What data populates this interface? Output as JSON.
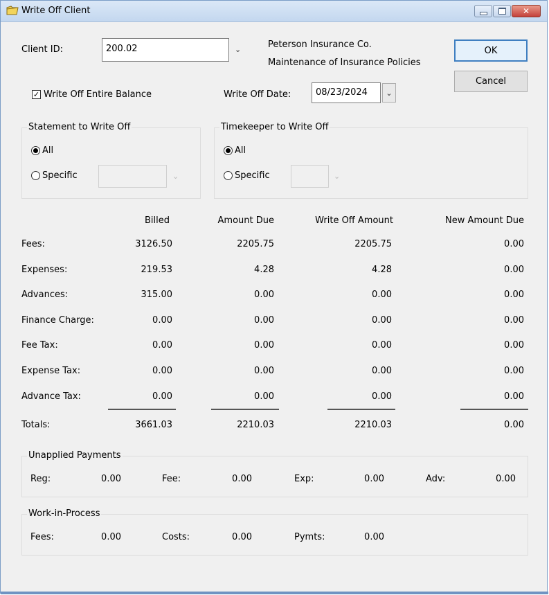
{
  "window": {
    "title": "Write Off Client",
    "icon": "folder-icon",
    "controls": [
      "minimize-icon",
      "maximize-icon",
      "close-icon"
    ]
  },
  "client": {
    "label": "Client ID:",
    "value": "200.02",
    "name": "Peterson Insurance Co.",
    "matter": "Maintenance of Insurance Policies"
  },
  "buttons": {
    "ok": "OK",
    "cancel": "Cancel"
  },
  "write_off_entire": {
    "label": "Write Off Entire Balance",
    "checked": true
  },
  "write_off_date": {
    "label": "Write Off Date:",
    "value": "08/23/2024"
  },
  "statement_group": {
    "title": "Statement to Write Off",
    "all_label": "All",
    "specific_label": "Specific",
    "selected": "All"
  },
  "timekeeper_group": {
    "title": "Timekeeper to Write Off",
    "all_label": "All",
    "specific_label": "Specific",
    "selected": "All"
  },
  "table": {
    "headers": [
      "Billed",
      "Amount Due",
      "Write Off Amount",
      "New Amount Due"
    ],
    "rows": [
      {
        "label": "Fees:",
        "billed": "3126.50",
        "due": "2205.75",
        "writeoff": "2205.75",
        "newdue": "0.00"
      },
      {
        "label": "Expenses:",
        "billed": "219.53",
        "due": "4.28",
        "writeoff": "4.28",
        "newdue": "0.00"
      },
      {
        "label": "Advances:",
        "billed": "315.00",
        "due": "0.00",
        "writeoff": "0.00",
        "newdue": "0.00"
      },
      {
        "label": "Finance Charge:",
        "billed": "0.00",
        "due": "0.00",
        "writeoff": "0.00",
        "newdue": "0.00"
      },
      {
        "label": "Fee Tax:",
        "billed": "0.00",
        "due": "0.00",
        "writeoff": "0.00",
        "newdue": "0.00"
      },
      {
        "label": "Expense Tax:",
        "billed": "0.00",
        "due": "0.00",
        "writeoff": "0.00",
        "newdue": "0.00"
      },
      {
        "label": "Advance Tax:",
        "billed": "0.00",
        "due": "0.00",
        "writeoff": "0.00",
        "newdue": "0.00"
      }
    ],
    "totals": {
      "label": "Totals:",
      "billed": "3661.03",
      "due": "2210.03",
      "writeoff": "2210.03",
      "newdue": "0.00"
    }
  },
  "unapplied": {
    "title": "Unapplied Payments",
    "reg_label": "Reg:",
    "reg": "0.00",
    "fee_label": "Fee:",
    "fee": "0.00",
    "exp_label": "Exp:",
    "exp": "0.00",
    "adv_label": "Adv:",
    "adv": "0.00"
  },
  "wip": {
    "title": "Work-in-Process",
    "fees_label": "Fees:",
    "fees": "0.00",
    "costs_label": "Costs:",
    "costs": "0.00",
    "pymts_label": "Pymts:",
    "pymts": "0.00"
  }
}
